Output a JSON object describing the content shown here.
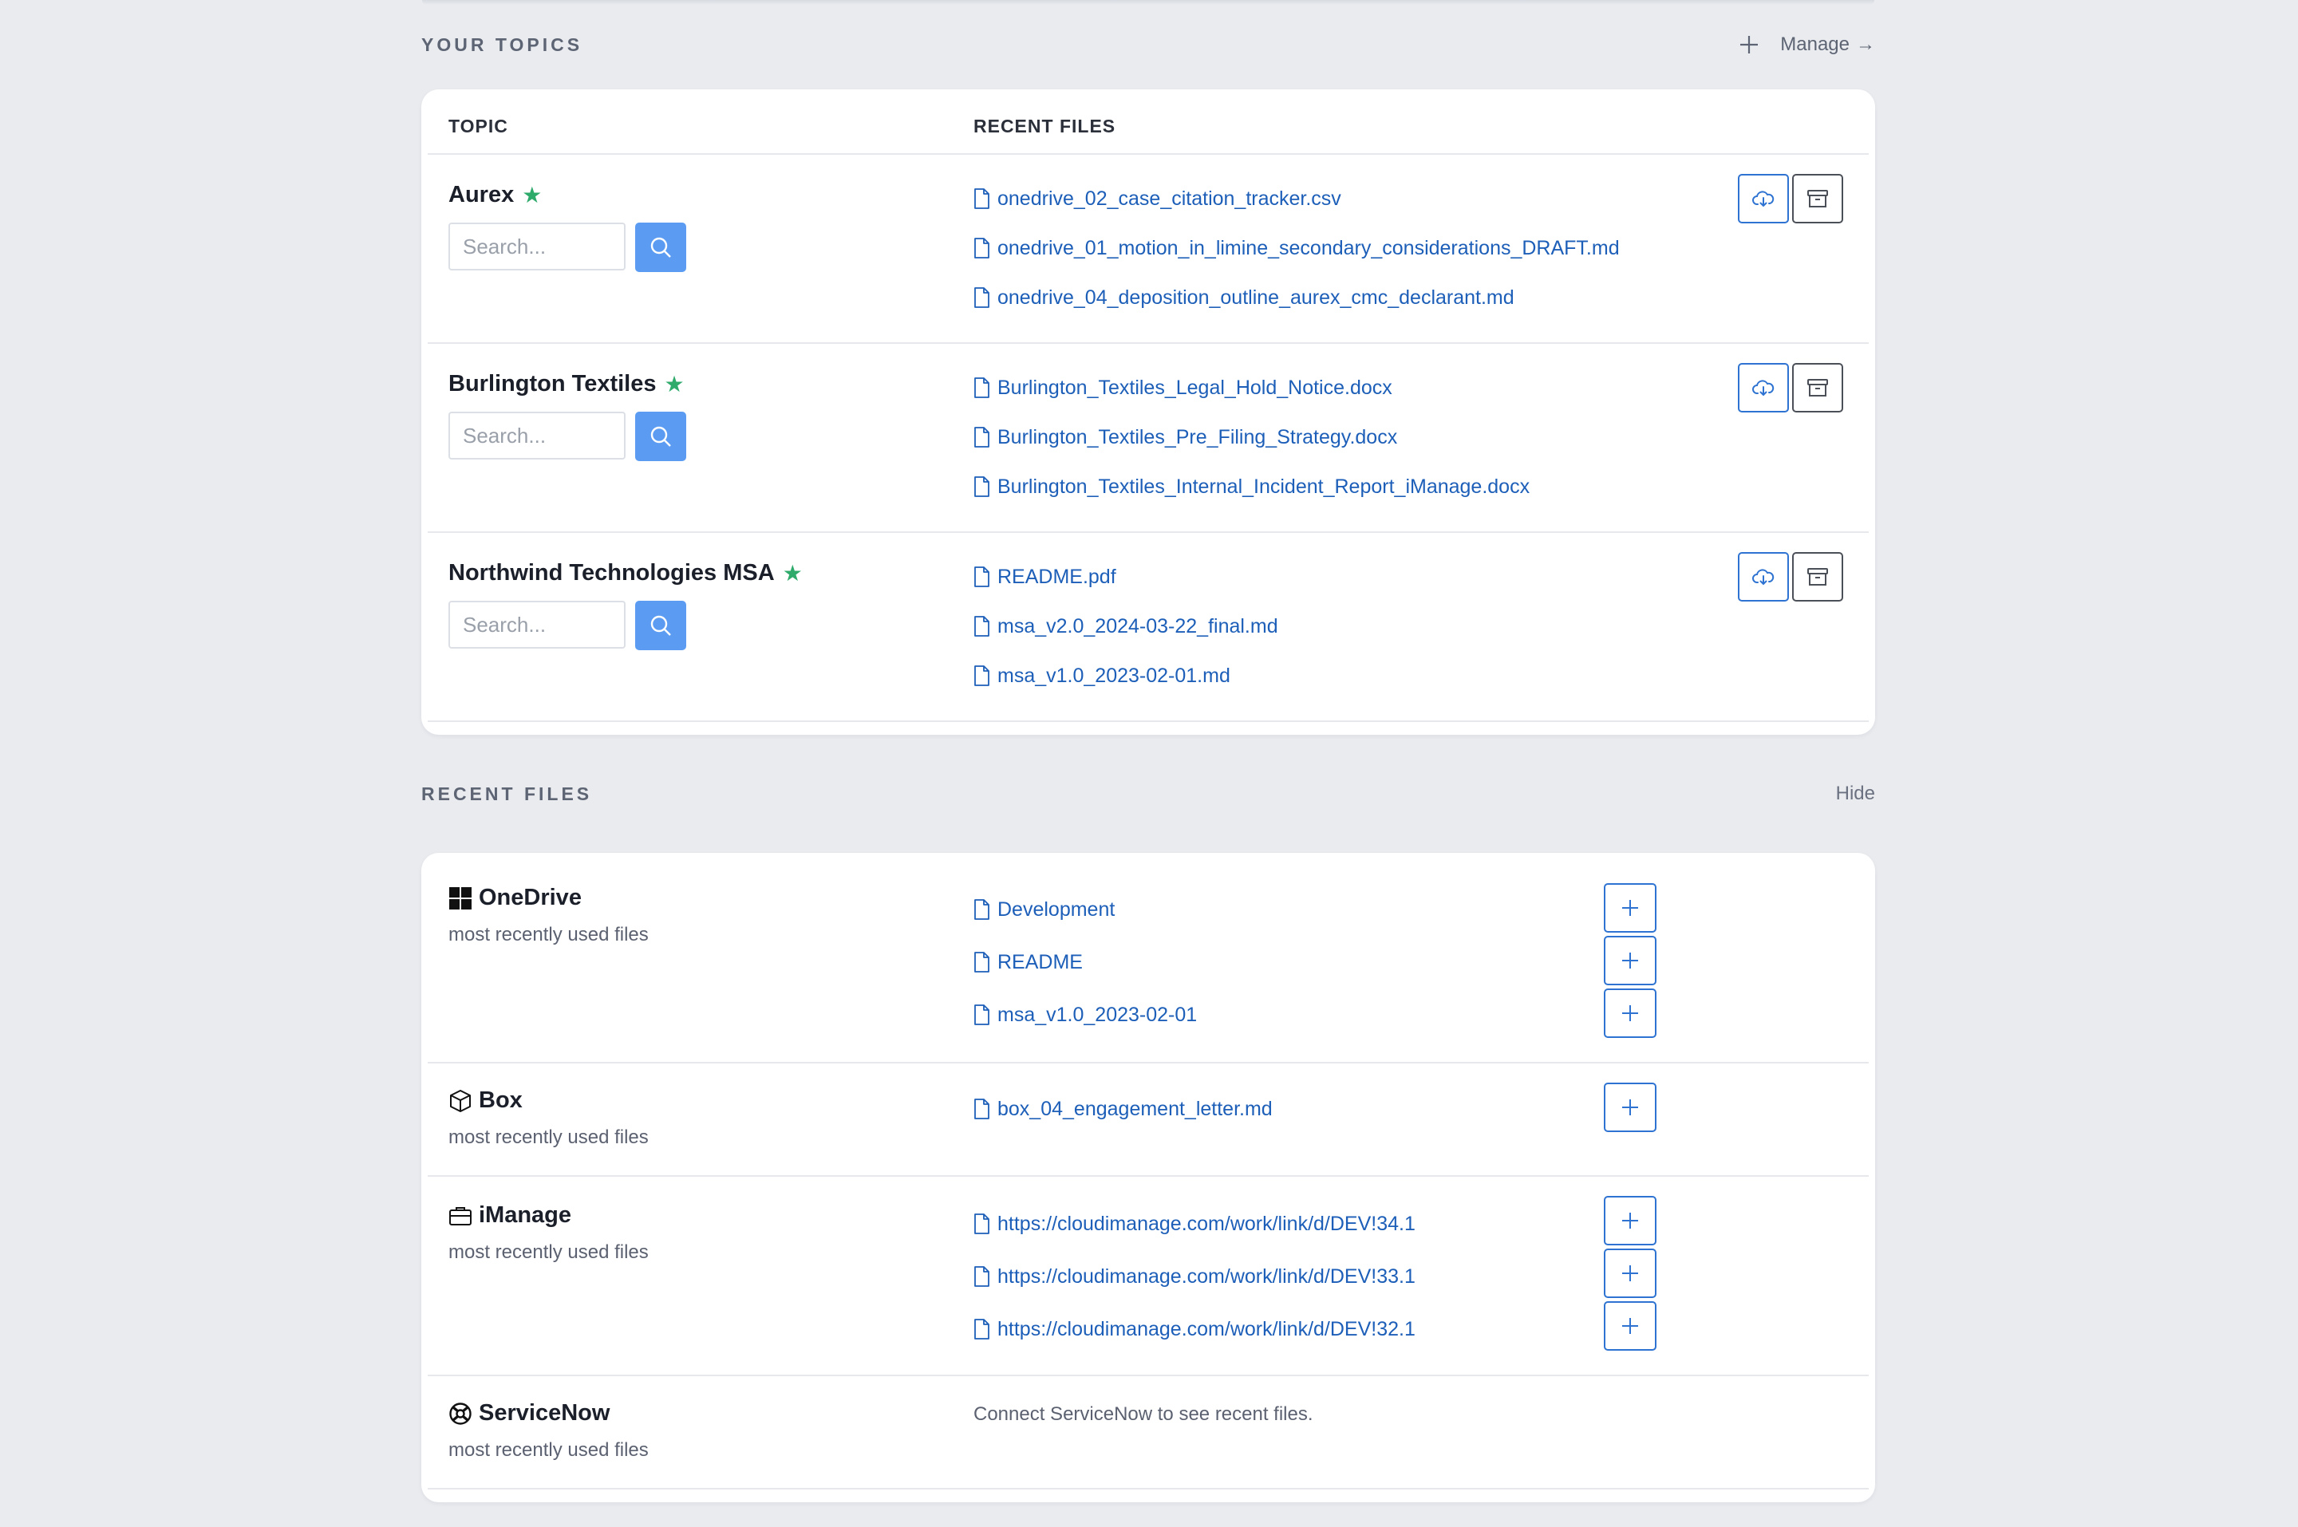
{
  "topics_section": {
    "title": "YOUR TOPICS",
    "manage_label": "Manage",
    "manage_arrow": "→",
    "col_topic": "TOPIC",
    "col_recent": "RECENT FILES",
    "search_placeholder": "Search...",
    "topics": [
      {
        "name": "Aurex",
        "starred": true,
        "files": [
          "onedrive_02_case_citation_tracker.csv",
          "onedrive_01_motion_in_limine_secondary_considerations_DRAFT.md",
          "onedrive_04_deposition_outline_aurex_cmc_declarant.md"
        ]
      },
      {
        "name": "Burlington Textiles",
        "starred": true,
        "files": [
          "Burlington_Textiles_Legal_Hold_Notice.docx",
          "Burlington_Textiles_Pre_Filing_Strategy.docx",
          "Burlington_Textiles_Internal_Incident_Report_iManage.docx"
        ]
      },
      {
        "name": "Northwind Technologies MSA",
        "starred": true,
        "files": [
          "README.pdf",
          "msa_v2.0_2024-03-22_final.md",
          "msa_v1.0_2023-02-01.md"
        ]
      }
    ]
  },
  "recent_section": {
    "title": "RECENT FILES",
    "hide_label": "Hide",
    "sources": [
      {
        "name": "OneDrive",
        "icon": "windows-grid-icon",
        "subtitle": "most recently used files",
        "files": [
          "Development",
          "README",
          "msa_v1.0_2023-02-01"
        ]
      },
      {
        "name": "Box",
        "icon": "box-cube-icon",
        "subtitle": "most recently used files",
        "files": [
          "box_04_engagement_letter.md"
        ]
      },
      {
        "name": "iManage",
        "icon": "briefcase-icon",
        "subtitle": "most recently used files",
        "files": [
          "https://cloudimanage.com/work/link/d/DEV!34.1",
          "https://cloudimanage.com/work/link/d/DEV!33.1",
          "https://cloudimanage.com/work/link/d/DEV!32.1"
        ]
      },
      {
        "name": "ServiceNow",
        "icon": "servicenow-icon",
        "subtitle": "most recently used files",
        "message": "Connect ServiceNow to see recent files."
      }
    ]
  },
  "colors": {
    "accent": "#2e73d1",
    "link": "#1d5fb8",
    "search_button": "#5b9cf2",
    "star": "#2eaa6b",
    "background": "#e9ebef"
  }
}
